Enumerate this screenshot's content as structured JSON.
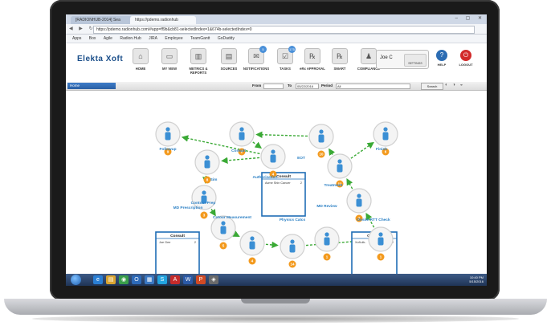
{
  "browser": {
    "tabs": [
      "[RADIONHUB-2014] Sea",
      "https://pdemo.radionhub"
    ],
    "window_controls": "– ▢ ✕",
    "url": "https://pdemo.radionhub.com/#app=ff9b&cb81-selectedIndex=1&674b-selectedIndex=0",
    "bookmarks": [
      "Apps",
      "Box",
      "Agile",
      "Radion.Hub",
      "JIRA",
      "Employee",
      "TeamGantt",
      "GoDaddy"
    ]
  },
  "app": {
    "logo": "Elekta Xoft",
    "nav": [
      {
        "label": "HOME",
        "icon": "home-icon",
        "glyph": "⌂",
        "badge": ""
      },
      {
        "label": "MY VIEW",
        "icon": "monitor-icon",
        "glyph": "▭",
        "badge": ""
      },
      {
        "label": "METRICS & REPORTS",
        "icon": "bar-chart-icon",
        "glyph": "▥",
        "badge": ""
      },
      {
        "label": "SOURCES",
        "icon": "folder-icon",
        "glyph": "▤",
        "badge": ""
      },
      {
        "label": "NOTIFICATIONS",
        "icon": "bell-icon",
        "glyph": "✉",
        "badge": "5"
      },
      {
        "label": "TASKS",
        "icon": "tasks-icon",
        "glyph": "☑",
        "badge": "175"
      },
      {
        "label": "eRx APPROVAL",
        "icon": "rx-icon",
        "glyph": "℞",
        "badge": ""
      },
      {
        "label": "SMART",
        "icon": "smart-rx-icon",
        "glyph": "℞",
        "badge": ""
      },
      {
        "label": "COMPLIANCE",
        "icon": "compliance-icon",
        "glyph": "♟",
        "badge": ""
      }
    ],
    "user": {
      "name": "Joe C",
      "settings_label": "SETTINGS"
    },
    "help_label": "HELP",
    "logout_label": "LOGOUT",
    "colors": {
      "brand": "#1b4f8a",
      "node_blue": "#3b8fd4",
      "step_orange": "#f39a1e",
      "arrow_green": "#3aa935",
      "logout_red": "#d22a2a"
    }
  },
  "toolbar": {
    "breadcrumb": "Home",
    "from_label": "From",
    "from_value": "",
    "to_label": "To",
    "to_value": "05/22/2016",
    "period_label": "Period",
    "period_value": "All",
    "search_label": "Search"
  },
  "workflow": {
    "nodes": [
      {
        "id": "followup",
        "label": "Followup",
        "step": "9"
      },
      {
        "id": "consult",
        "label": "Consult",
        "step": "2"
      },
      {
        "id": "authorization",
        "label": "Authorization",
        "step": "4"
      },
      {
        "id": "eot",
        "label": "EOT",
        "step": "10"
      },
      {
        "id": "finish",
        "label": "Finish",
        "step": "6"
      },
      {
        "id": "sim",
        "label": "Sim",
        "step": "8"
      },
      {
        "id": "treatment",
        "label": "Treatment",
        "step": "11"
      },
      {
        "id": "md-prescription",
        "label": "MD Prescription",
        "step": "3"
      },
      {
        "id": "onsite-rtt-check",
        "label": "Onsite RTT Check",
        "step": "7"
      },
      {
        "id": "contour-prep",
        "label": "Contour Prep",
        "step": "5"
      },
      {
        "id": "md-review",
        "label": "MD Review",
        "step": "1"
      },
      {
        "id": "contour-measurement",
        "label": "Cotour Measurement",
        "step": "4"
      },
      {
        "id": "physics-calcs",
        "label": "Physics Calcs",
        "step": "14"
      },
      {
        "id": "final",
        "label": "",
        "step": "1"
      }
    ],
    "popups": [
      {
        "id": "consult-center",
        "title": "Consult",
        "row": "Acme Shin Cancer",
        "count": "2"
      },
      {
        "id": "consult-left",
        "title": "Consult",
        "row": "Joe Gee",
        "count": "2"
      },
      {
        "id": "consult-right",
        "title": "Consult",
        "row": "Xoft-db-",
        "count": "2"
      }
    ]
  },
  "taskbar": {
    "apps": [
      {
        "icon": "ie-icon",
        "glyph": "e",
        "color": "#2a7fd4"
      },
      {
        "icon": "explorer-icon",
        "glyph": "▤",
        "color": "#d9a431"
      },
      {
        "icon": "chrome-icon",
        "glyph": "◉",
        "color": "#3a9f4a"
      },
      {
        "icon": "outlook-icon",
        "glyph": "O",
        "color": "#2d6ab8"
      },
      {
        "icon": "calendar-icon",
        "glyph": "▦",
        "color": "#3b78c2"
      },
      {
        "icon": "skype-icon",
        "glyph": "S",
        "color": "#22a4e0"
      },
      {
        "icon": "acrobat-icon",
        "glyph": "A",
        "color": "#c62b2b"
      },
      {
        "icon": "word-icon",
        "glyph": "W",
        "color": "#2b5aa8"
      },
      {
        "icon": "powerpoint-icon",
        "glyph": "P",
        "color": "#d04a24"
      },
      {
        "icon": "media-icon",
        "glyph": "◈",
        "color": "#6a6a6a"
      }
    ],
    "time": "10:40 PM",
    "date": "5/15/2016"
  }
}
